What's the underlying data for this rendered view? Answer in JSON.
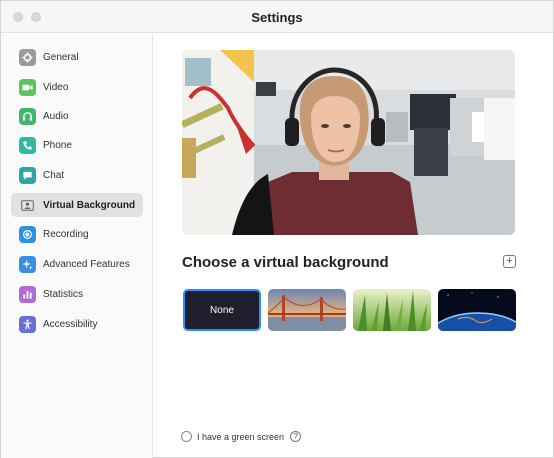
{
  "window": {
    "title": "Settings"
  },
  "sidebar": {
    "items": [
      {
        "label": "General",
        "icon": "gear-icon",
        "color": "#9b9b9b",
        "active": false
      },
      {
        "label": "Video",
        "icon": "video-camera-icon",
        "color": "#5cc55f",
        "active": false
      },
      {
        "label": "Audio",
        "icon": "headphones-icon",
        "color": "#3fb86a",
        "active": false
      },
      {
        "label": "Phone",
        "icon": "phone-icon",
        "color": "#30b8a5",
        "active": false
      },
      {
        "label": "Chat",
        "icon": "chat-bubble-icon",
        "color": "#2aa7a3",
        "active": false
      },
      {
        "label": "Virtual Background",
        "icon": "person-background-icon",
        "color": "#e1e1e1",
        "active": true
      },
      {
        "label": "Recording",
        "icon": "record-icon",
        "color": "#2f8fe6",
        "active": false
      },
      {
        "label": "Advanced Features",
        "icon": "sparkle-icon",
        "color": "#3a8ee6",
        "active": false
      },
      {
        "label": "Statistics",
        "icon": "bar-chart-icon",
        "color": "#b06ad8",
        "active": false
      },
      {
        "label": "Accessibility",
        "icon": "accessibility-icon",
        "color": "#6a6fd8",
        "active": false
      }
    ]
  },
  "main": {
    "heading": "Choose a virtual background",
    "add_icon": "plus-icon",
    "backgrounds": [
      {
        "label": "None",
        "selected": true
      },
      {
        "label": "",
        "scene": "golden-gate-bridge"
      },
      {
        "label": "",
        "scene": "grass"
      },
      {
        "label": "",
        "scene": "earth-from-space"
      }
    ],
    "green_screen_label": "I have a green screen",
    "help_icon": "question-icon"
  },
  "colors": {
    "accent": "#2d8cff"
  }
}
